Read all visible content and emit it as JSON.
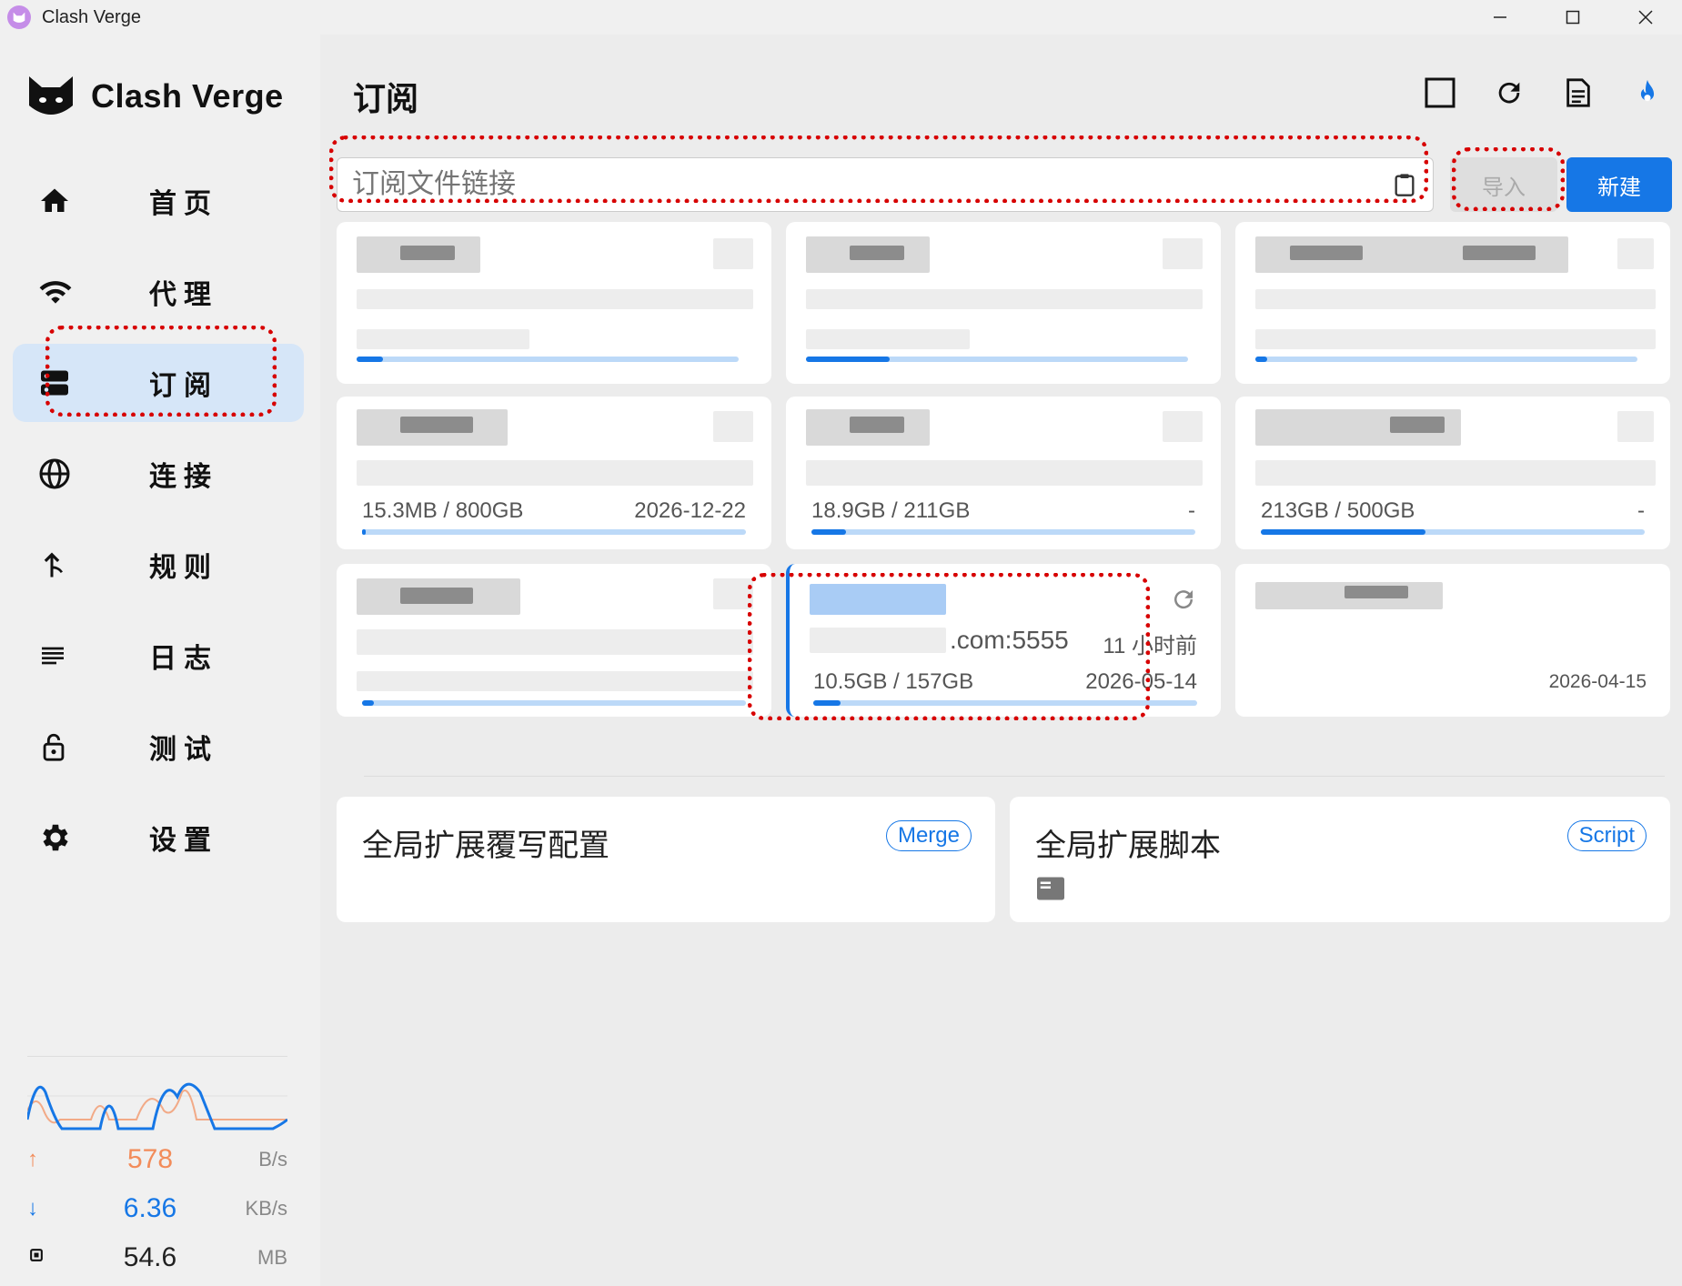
{
  "window": {
    "title": "Clash Verge",
    "minimize": "—",
    "maximize": "☐",
    "close": "✕"
  },
  "sidebar": {
    "logo_text": "Clash Verge",
    "items": [
      {
        "label": "首页",
        "icon": "home-icon"
      },
      {
        "label": "代理",
        "icon": "wifi-icon"
      },
      {
        "label": "订阅",
        "icon": "server-icon",
        "active": true
      },
      {
        "label": "连接",
        "icon": "globe-icon"
      },
      {
        "label": "规则",
        "icon": "fork-arrow-icon"
      },
      {
        "label": "日志",
        "icon": "lines-icon"
      },
      {
        "label": "测试",
        "icon": "lock-icon"
      },
      {
        "label": "设置",
        "icon": "gear-icon"
      }
    ],
    "traffic": {
      "up": {
        "value": "578",
        "unit": "B/s",
        "color": "#f28c5a"
      },
      "down": {
        "value": "6.36",
        "unit": "KB/s",
        "color": "#1677e6"
      },
      "memory": {
        "value": "54.6",
        "unit": "MB"
      }
    }
  },
  "main": {
    "title": "订阅",
    "toolbar": [
      "square-icon",
      "refresh-icon",
      "document-icon",
      "flame-icon"
    ],
    "import": {
      "placeholder": "订阅文件链接",
      "import_label": "导入",
      "new_label": "新建"
    },
    "profiles": [
      {
        "usage": "",
        "expire": ""
      },
      {
        "usage": "",
        "expire": ""
      },
      {
        "usage": "",
        "expire": ""
      },
      {
        "usage": "15.3MB / 800GB",
        "expire": "2026-12-22"
      },
      {
        "usage": "18.9GB / 211GB",
        "expire": "-"
      },
      {
        "usage": "213GB / 500GB",
        "expire": "-"
      },
      {
        "usage": "",
        "expire": ""
      },
      {
        "url": ".com:5555",
        "updated": "11 小时前",
        "usage": "10.5GB / 157GB",
        "expire": "2026-05-14"
      },
      {
        "usage": "",
        "expire": "2026-04-15"
      }
    ],
    "extensions": [
      {
        "title": "全局扩展覆写配置",
        "tag": "Merge"
      },
      {
        "title": "全局扩展脚本",
        "tag": "Script"
      }
    ]
  },
  "colors": {
    "accent": "#1677e6",
    "active_bg": "#d6e6f8",
    "highlight": "#d70000"
  }
}
